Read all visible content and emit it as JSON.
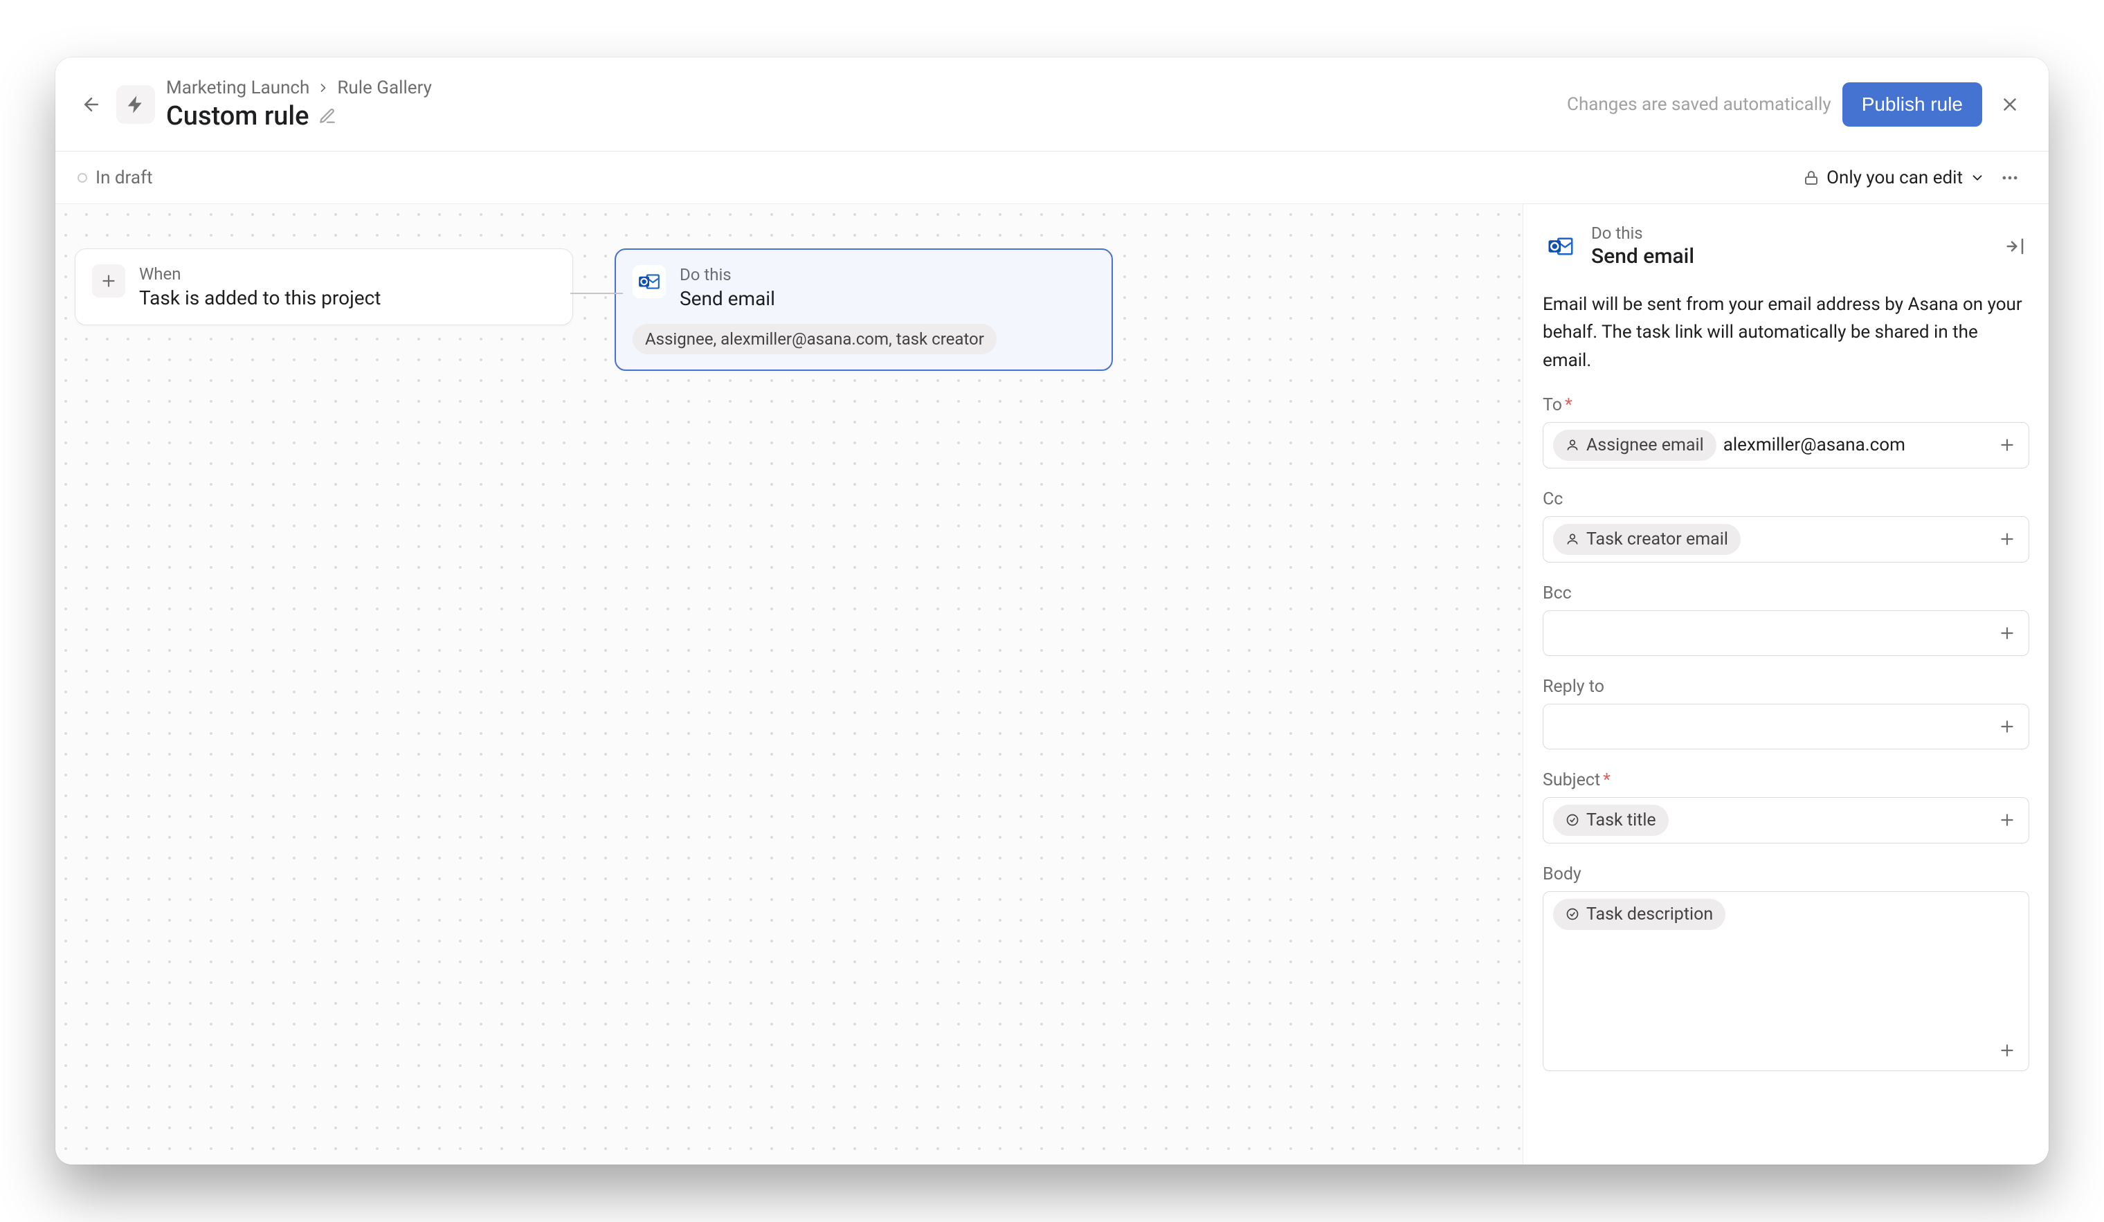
{
  "header": {
    "breadcrumb": {
      "project": "Marketing Launch",
      "section": "Rule Gallery"
    },
    "title": "Custom rule",
    "save_note": "Changes are saved automatically",
    "publish_label": "Publish rule"
  },
  "subheader": {
    "status": "In draft",
    "edit_scope": "Only you can edit"
  },
  "canvas": {
    "trigger": {
      "eyebrow": "When",
      "title": "Task is added to this project"
    },
    "action": {
      "eyebrow": "Do this",
      "title": "Send email",
      "summary": "Assignee, alexmiller@asana.com, task creator"
    }
  },
  "panel": {
    "eyebrow": "Do this",
    "title": "Send email",
    "description": "Email will be sent from your email address by Asana on your behalf. The task link will automatically be shared in the email.",
    "fields": {
      "to": {
        "label": "To",
        "required": true,
        "tokens": [
          "Assignee email"
        ],
        "text": "alexmiller@asana.com"
      },
      "cc": {
        "label": "Cc",
        "required": false,
        "tokens": [
          "Task creator email"
        ]
      },
      "bcc": {
        "label": "Bcc",
        "required": false
      },
      "reply_to": {
        "label": "Reply to",
        "required": false
      },
      "subject": {
        "label": "Subject",
        "required": true,
        "tokens": [
          "Task title"
        ]
      },
      "body": {
        "label": "Body",
        "required": false,
        "tokens": [
          "Task description"
        ]
      }
    }
  }
}
